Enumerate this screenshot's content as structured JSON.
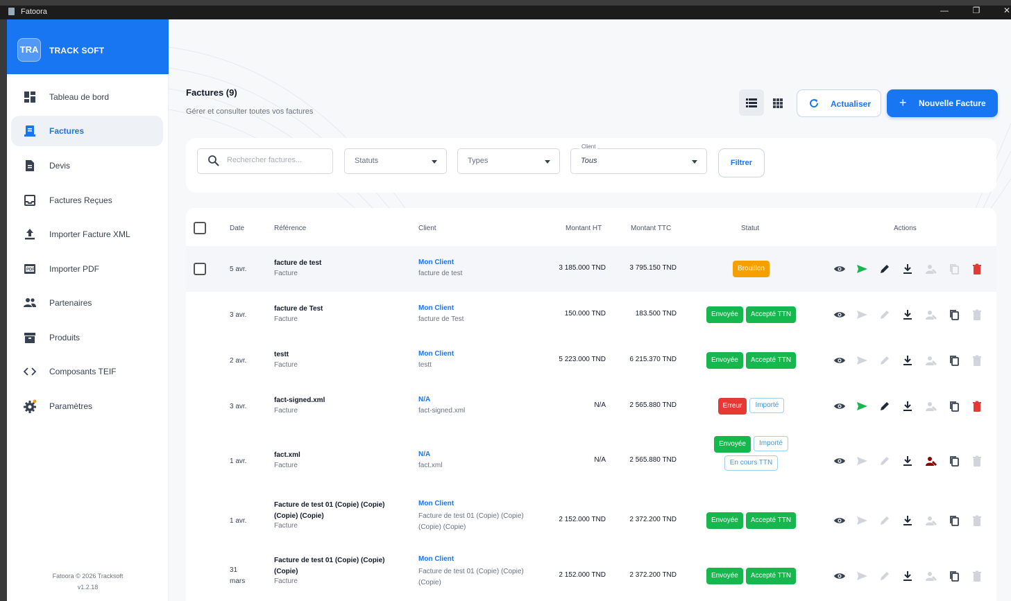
{
  "window": {
    "title": "Fatoora"
  },
  "brand": {
    "logo": "TRA",
    "name": "TRACK SOFT"
  },
  "sidebar": {
    "items": [
      {
        "label": "Tableau de bord",
        "icon": "dashboard-icon"
      },
      {
        "label": "Factures",
        "icon": "invoice-icon",
        "active": true
      },
      {
        "label": "Devis",
        "icon": "quote-doc-icon"
      },
      {
        "label": "Factures Reçues",
        "icon": "inbox-icon"
      },
      {
        "label": "Importer Facture XML",
        "icon": "upload-icon"
      },
      {
        "label": "Importer PDF",
        "icon": "pdf-icon"
      },
      {
        "label": "Partenaires",
        "icon": "people-icon"
      },
      {
        "label": "Produits",
        "icon": "archive-icon"
      },
      {
        "label": "Composants TEIF",
        "icon": "code-icon"
      },
      {
        "label": "Paramètres",
        "icon": "gear-icon"
      }
    ],
    "footer_line1": "Fatoora © 2026 Tracksoft",
    "footer_line2": "v1.2.18"
  },
  "header": {
    "title": "Factures (9)",
    "subtitle": "Gérer et consulter toutes vos factures",
    "refresh_label": "Actualiser",
    "new_label": "Nouvelle Facture"
  },
  "filters": {
    "search_placeholder": "Rechercher factures...",
    "status_value": "Statuts",
    "type_value": "Types",
    "client_label": "Client",
    "client_value": "Tous",
    "filter_label": "Filtrer"
  },
  "table": {
    "headers": {
      "date": "Date",
      "reference": "Référence",
      "client": "Client",
      "ht": "Montant HT",
      "ttc": "Montant TTC",
      "status": "Statut",
      "actions": "Actions"
    },
    "rows": [
      {
        "date": "5 avr.",
        "ref": "facture de test",
        "type": "Facture",
        "client": "Mon Client",
        "client_sub": "facture de test",
        "ht": "3 185.000 TND",
        "ttc": "3 795.150 TND",
        "badges": [
          {
            "label": "Brouillon",
            "style": "orange"
          }
        ]
      },
      {
        "date": "3 avr.",
        "ref": "facture de Test",
        "type": "Facture",
        "client": "Mon Client",
        "client_sub": "facture de Test",
        "ht": "150.000 TND",
        "ttc": "183.500 TND",
        "badges": [
          {
            "label": "Envoyée",
            "style": "green"
          },
          {
            "label": "Accepté TTN",
            "style": "green"
          }
        ]
      },
      {
        "date": "2 avr.",
        "ref": "testt",
        "type": "Facture",
        "client": "Mon Client",
        "client_sub": "testt",
        "ht": "5 223.000 TND",
        "ttc": "6 215.370 TND",
        "badges": [
          {
            "label": "Envoyée",
            "style": "green"
          },
          {
            "label": "Accepté TTN",
            "style": "green"
          }
        ]
      },
      {
        "date": "3 avr.",
        "ref": "fact-signed.xml",
        "type": "Facture",
        "client": "N/A",
        "client_sub": "fact-signed.xml",
        "ht": "N/A",
        "ttc": "2 565.880 TND",
        "badges": [
          {
            "label": "Erreur",
            "style": "red"
          },
          {
            "label": "Importé",
            "style": "outline"
          }
        ]
      },
      {
        "date": "1 avr.",
        "ref": "fact.xml",
        "type": "Facture",
        "client": "N/A",
        "client_sub": "fact.xml",
        "ht": "N/A",
        "ttc": "2 565.880 TND",
        "badges": [
          {
            "label": "Envoyée",
            "style": "green"
          },
          {
            "label": "Importé",
            "style": "outline"
          },
          {
            "label": "En cours TTN",
            "style": "outline"
          }
        ]
      },
      {
        "date": "1 avr.",
        "ref": "Facture de test 01 (Copie) (Copie) (Copie) (Copie)",
        "type": "Facture",
        "client": "Mon Client",
        "client_sub": "Facture de test 01 (Copie) (Copie) (Copie) (Copie)",
        "ht": "2 152.000 TND",
        "ttc": "2 372.200 TND",
        "badges": [
          {
            "label": "Envoyée",
            "style": "green"
          },
          {
            "label": "Accepté TTN",
            "style": "green"
          }
        ]
      },
      {
        "date": "31 mars",
        "ref": "Facture de test 01 (Copie) (Copie) (Copie)",
        "type": "Facture",
        "client": "Mon Client",
        "client_sub": "Facture de test 01 (Copie) (Copie) (Copie)",
        "ht": "2 152.000 TND",
        "ttc": "2 372.200 TND",
        "badges": [
          {
            "label": "Envoyée",
            "style": "green"
          },
          {
            "label": "Accepté TTN",
            "style": "green"
          }
        ]
      }
    ]
  },
  "colors": {
    "primary": "#1976f2",
    "success": "#16b84e",
    "warning": "#f5a000",
    "danger": "#e53935"
  }
}
